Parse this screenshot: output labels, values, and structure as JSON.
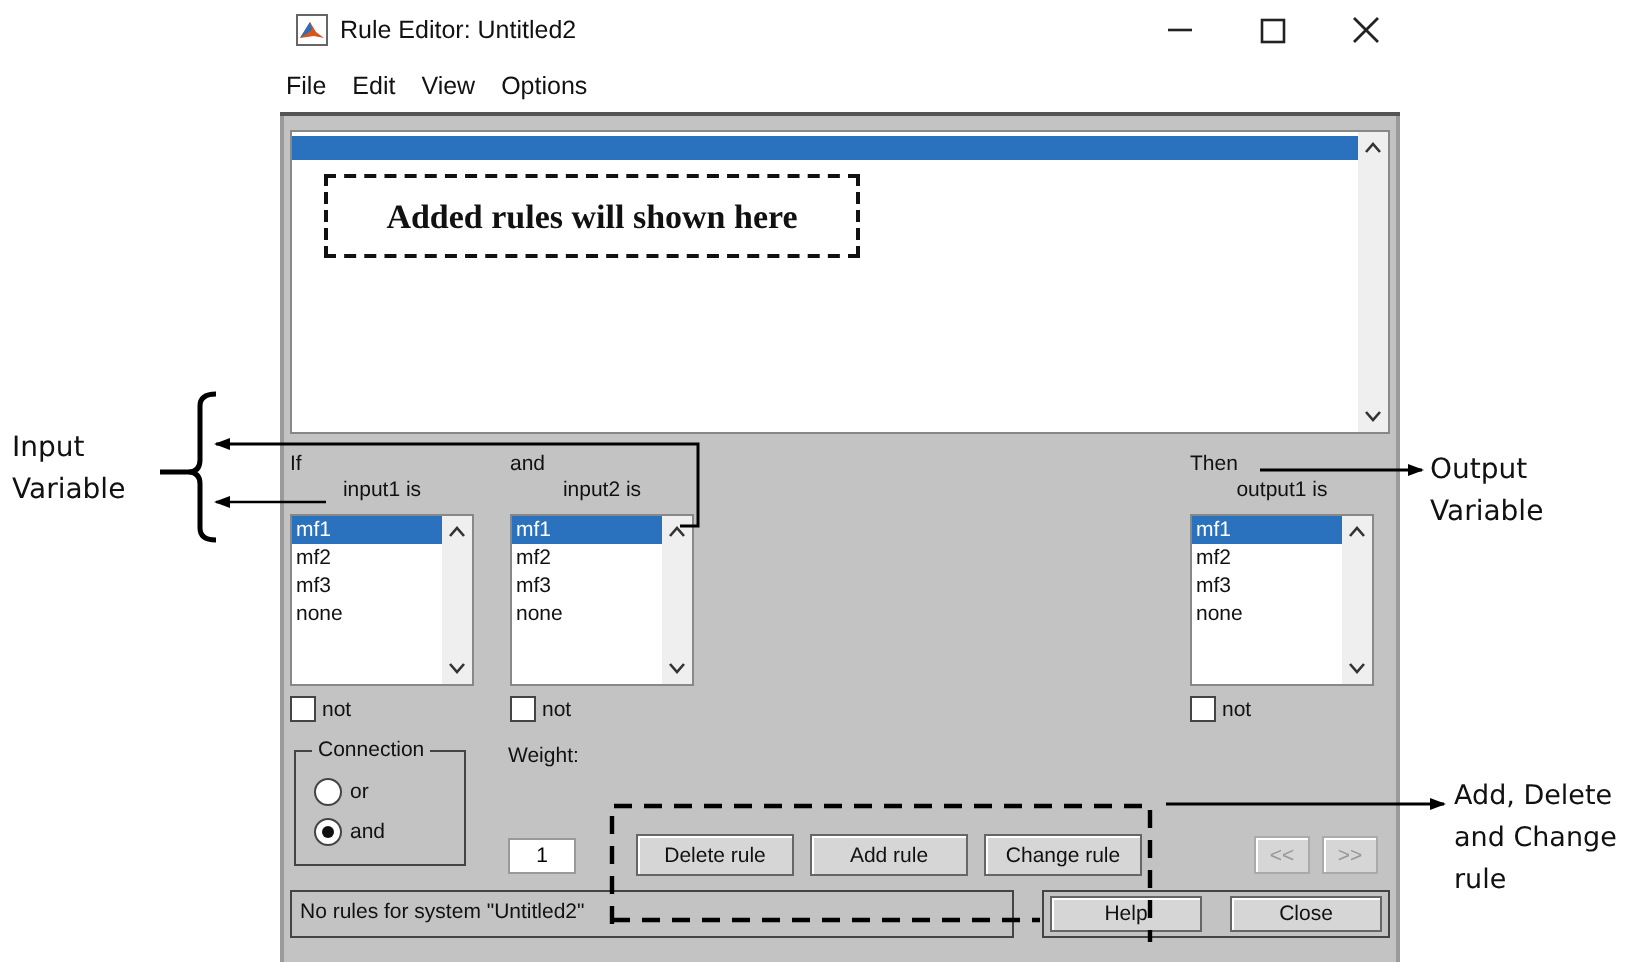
{
  "window": {
    "title": "Rule Editor: Untitled2"
  },
  "menu": [
    "File",
    "Edit",
    "View",
    "Options"
  ],
  "variables": [
    {
      "connector": "If",
      "label": "input1 is",
      "not_checked": false,
      "items": [
        {
          "label": "mf1",
          "selected": true
        },
        {
          "label": "mf2",
          "selected": false
        },
        {
          "label": "mf3",
          "selected": false
        },
        {
          "label": "none",
          "selected": false
        }
      ],
      "not_label": "not"
    },
    {
      "connector": "and",
      "label": "input2 is",
      "not_checked": false,
      "items": [
        {
          "label": "mf1",
          "selected": true
        },
        {
          "label": "mf2",
          "selected": false
        },
        {
          "label": "mf3",
          "selected": false
        },
        {
          "label": "none",
          "selected": false
        }
      ],
      "not_label": "not"
    },
    {
      "connector": "Then",
      "label": "output1 is",
      "not_checked": false,
      "items": [
        {
          "label": "mf1",
          "selected": true
        },
        {
          "label": "mf2",
          "selected": false
        },
        {
          "label": "mf3",
          "selected": false
        },
        {
          "label": "none",
          "selected": false
        }
      ],
      "not_label": "not"
    }
  ],
  "connection": {
    "title": "Connection",
    "options": [
      {
        "label": "or",
        "selected": false
      },
      {
        "label": "and",
        "selected": true
      }
    ]
  },
  "weight": {
    "label": "Weight:",
    "value": "1"
  },
  "buttons": [
    {
      "label": "Delete rule",
      "disabled": false
    },
    {
      "label": "Add rule",
      "disabled": false
    },
    {
      "label": "Change rule",
      "disabled": false
    }
  ],
  "nav_buttons": [
    {
      "label": "<<",
      "disabled": true
    },
    {
      "label": ">>",
      "disabled": true
    }
  ],
  "status_bar": "No rules for system \"Untitled2\"",
  "footer_buttons": [
    "Help",
    "Close"
  ],
  "annotations": [
    {
      "kind": "rules",
      "text": "Added rules will shown here"
    },
    {
      "kind": "input",
      "text": "Input Variable"
    },
    {
      "kind": "output",
      "text": "Output Variable"
    },
    {
      "kind": "buttons",
      "text": "Add, Delete and Change rule"
    }
  ]
}
